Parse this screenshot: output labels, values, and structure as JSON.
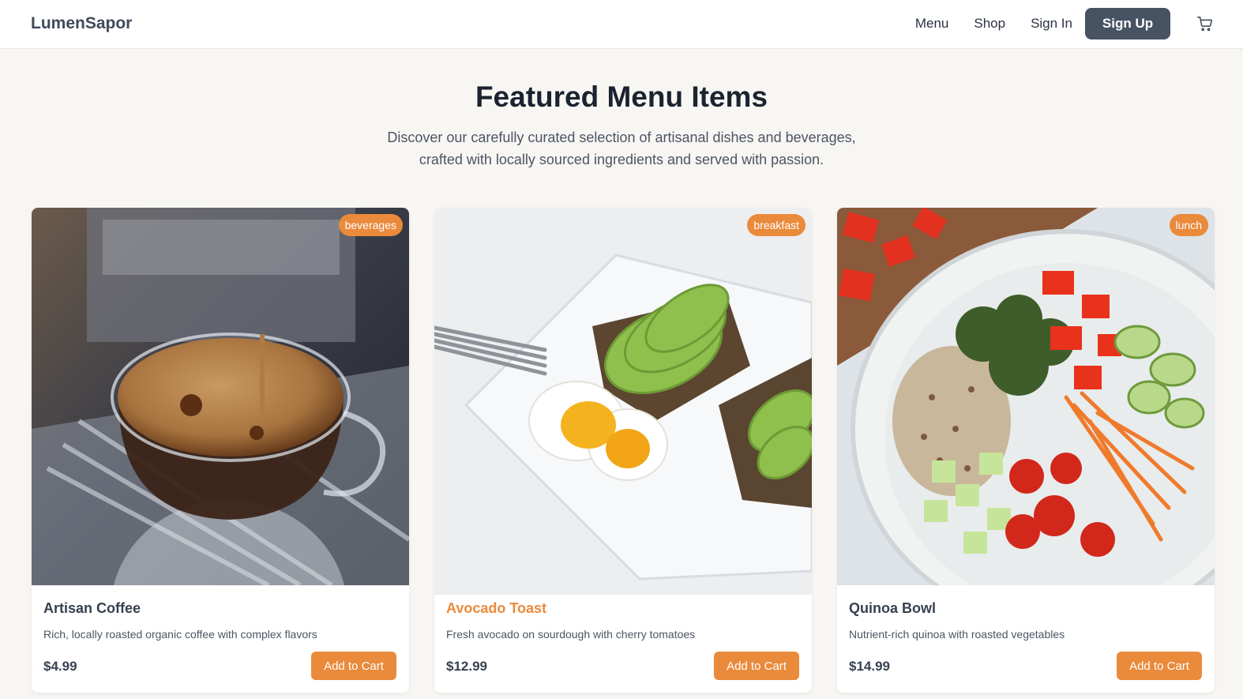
{
  "brand": "LumenSapor",
  "nav": {
    "menu": "Menu",
    "shop": "Shop",
    "sign_in": "Sign In",
    "sign_up": "Sign Up",
    "cart_icon": "cart-icon"
  },
  "hero": {
    "title": "Featured Menu Items",
    "subtitle_line1": "Discover our carefully curated selection of artisanal dishes and beverages,",
    "subtitle_line2": "crafted with locally sourced ingredients and served with passion."
  },
  "items": [
    {
      "badge": "beverages",
      "title": "Artisan Coffee",
      "description": "Rich, locally roasted organic coffee with complex flavors",
      "price": "$4.99",
      "button": "Add to Cart",
      "image": "espresso-cup-photo"
    },
    {
      "badge": "breakfast",
      "title": "Avocado Toast",
      "description": "Fresh avocado on sourdough with cherry tomatoes",
      "price": "$12.99",
      "button": "Add to Cart",
      "image": "avocado-toast-photo"
    },
    {
      "badge": "lunch",
      "title": "Quinoa Bowl",
      "description": "Nutrient-rich quinoa with roasted vegetables",
      "price": "$14.99",
      "button": "Add to Cart",
      "image": "quinoa-bowl-photo"
    }
  ],
  "colors": {
    "accent": "#ea8a3b",
    "signup": "#475263",
    "background": "#f8f6f3"
  }
}
